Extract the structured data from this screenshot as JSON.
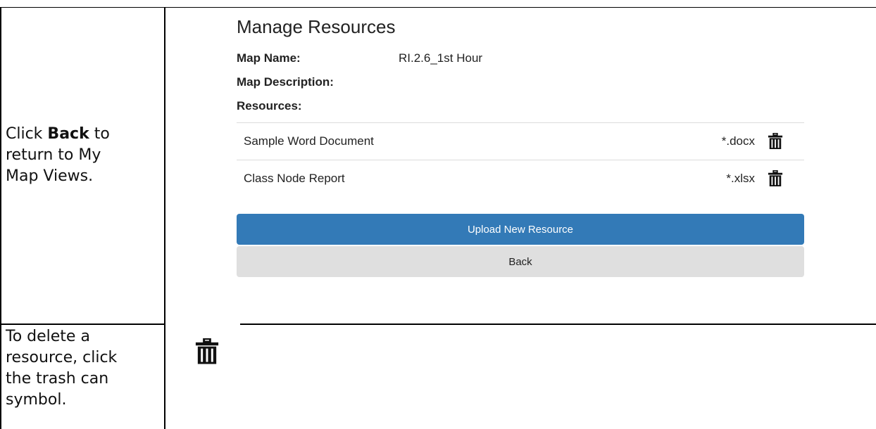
{
  "instructions": {
    "cell1": {
      "line1_prefix": "Click ",
      "line1_bold": "Back",
      "line1_suffix": " to",
      "line2": "return to My",
      "line3": "Map Views."
    },
    "cell2": {
      "line1": "To delete a",
      "line2": "resource, click",
      "line3": "the trash can",
      "line4": "symbol."
    }
  },
  "panel": {
    "title": "Manage Resources",
    "map_name_label": "Map Name:",
    "map_name_value": "RI.2.6_1st Hour",
    "map_description_label": "Map Description:",
    "resources_label": "Resources:",
    "resources": [
      {
        "name": "Sample Word Document",
        "ext": "*.docx",
        "icon": "trash-icon"
      },
      {
        "name": "Class Node Report",
        "ext": "*.xlsx",
        "icon": "trash-icon"
      }
    ],
    "upload_button": "Upload New Resource",
    "back_button": "Back"
  },
  "colors": {
    "primary_button": "#337ab7",
    "default_button": "#dfdfdf",
    "divider": "#dcdcdc"
  }
}
